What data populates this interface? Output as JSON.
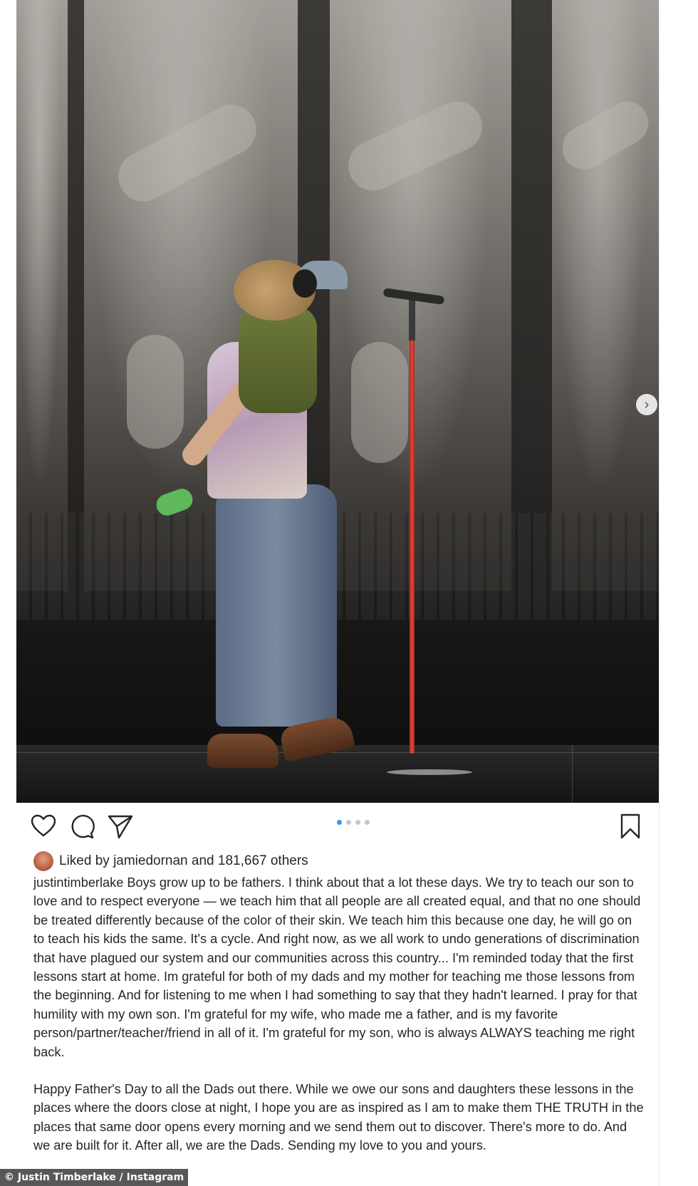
{
  "post": {
    "carousel": {
      "total_slides": 4,
      "active_slide": 1
    },
    "actions": {
      "like_icon": "heart-icon",
      "comment_icon": "comment-bubble-icon",
      "share_icon": "paper-plane-icon",
      "save_icon": "bookmark-icon",
      "next_icon": "chevron-right-icon"
    },
    "likes": {
      "prefix": "Liked by",
      "liker": "jamiedornan",
      "joiner": "and",
      "count": "181,667 others"
    },
    "caption": {
      "username": "justintimberlake",
      "paragraphs": [
        "Boys grow up to be fathers. I think about that a lot these days. We try to teach our son to love and to respect everyone — we teach him that all people are all created equal, and that no one should be treated differently because of the color of their skin. We teach him this because one day, he will go on to teach his kids the same. It's a cycle. And right now, as we all work to undo generations of discrimination that have plagued our system and our communities across this country... I'm reminded today that the first lessons start at home. Im grateful for both of my dads and my mother for teaching me those lessons from the beginning. And for listening to me when I had something to say that they hadn't learned. I pray for that humility with my own son. I'm grateful for my wife, who made me a father, and is my favorite person/partner/teacher/friend in all of it. I'm grateful for my son, who is always ALWAYS teaching me right back.",
        "Happy Father's Day to all the Dads out there. While we owe our sons and daughters these lessons in the places where the doors close at night, I hope you are as inspired as I am to make them THE TRUTH in the places that same door opens every morning and we send them out to discover. There's more to do. And we are built for it. After all, we are the Dads. Sending my love to you and yours."
      ]
    }
  },
  "credit": "© Justin Timberlake / Instagram",
  "colors": {
    "text": "#262626",
    "active_dot": "#3897f0",
    "inactive_dot": "#c7c7c7",
    "mic_stand": "#e2463a"
  }
}
